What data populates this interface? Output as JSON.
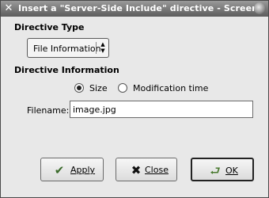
{
  "window": {
    "title": "Insert a \"Server-Side Include\" directive - Screem"
  },
  "directive_type": {
    "heading": "Directive Type",
    "selected": "File Information"
  },
  "directive_info": {
    "heading": "Directive Information",
    "radio_size_label": "Size",
    "radio_size_checked": true,
    "radio_modtime_label": "Modification time",
    "radio_modtime_checked": false,
    "filename_label": "Filename:",
    "filename_value": "image.jpg"
  },
  "buttons": {
    "apply": "Apply",
    "close": "Close",
    "ok": "OK"
  }
}
